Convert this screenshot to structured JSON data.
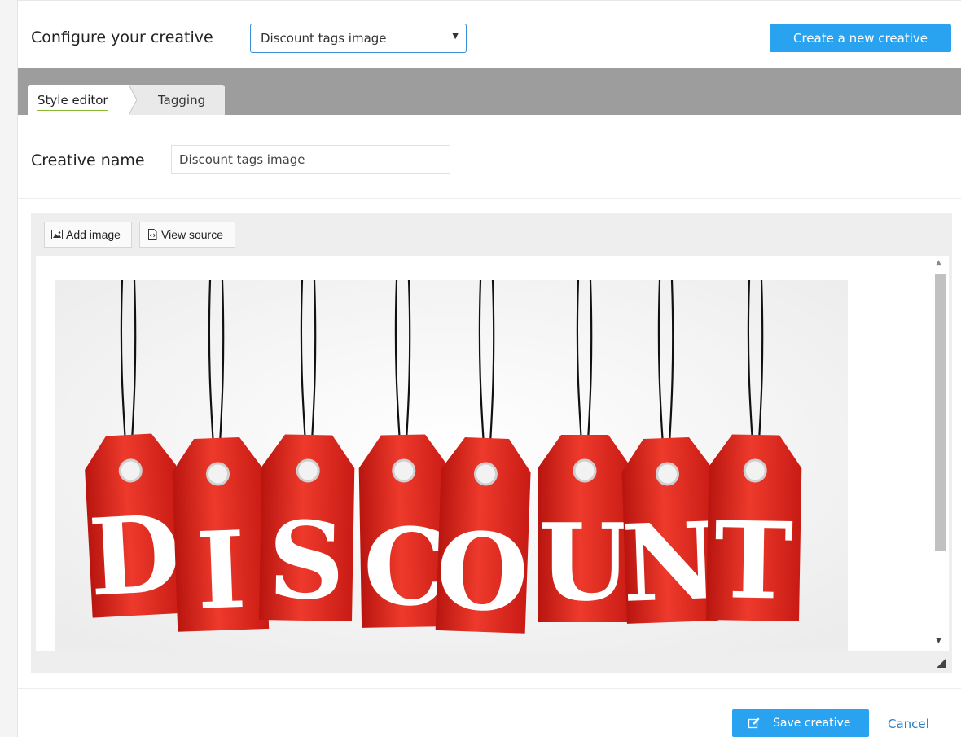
{
  "header": {
    "title": "Configure your creative",
    "creative_select": {
      "selected": "Discount tags image"
    },
    "create_button": "Create a new creative"
  },
  "tabs": [
    {
      "label": "Style editor",
      "active": true
    },
    {
      "label": "Tagging",
      "active": false
    }
  ],
  "form": {
    "name_label": "Creative name",
    "name_value": "Discount tags image"
  },
  "editor": {
    "toolbar": {
      "add_image": "Add image",
      "view_source": "View source"
    },
    "image": {
      "tag_letters": [
        "D",
        "I",
        "S",
        "C",
        "O",
        "U",
        "N",
        "T"
      ],
      "tag_color": "#e5291f"
    }
  },
  "footer": {
    "save_button": "Save creative",
    "cancel_link": "Cancel"
  },
  "colors": {
    "primary": "#29a3ef",
    "link": "#2a7fc4",
    "tabbar": "#9d9d9d",
    "active_tab_underline": "#8ab832"
  }
}
